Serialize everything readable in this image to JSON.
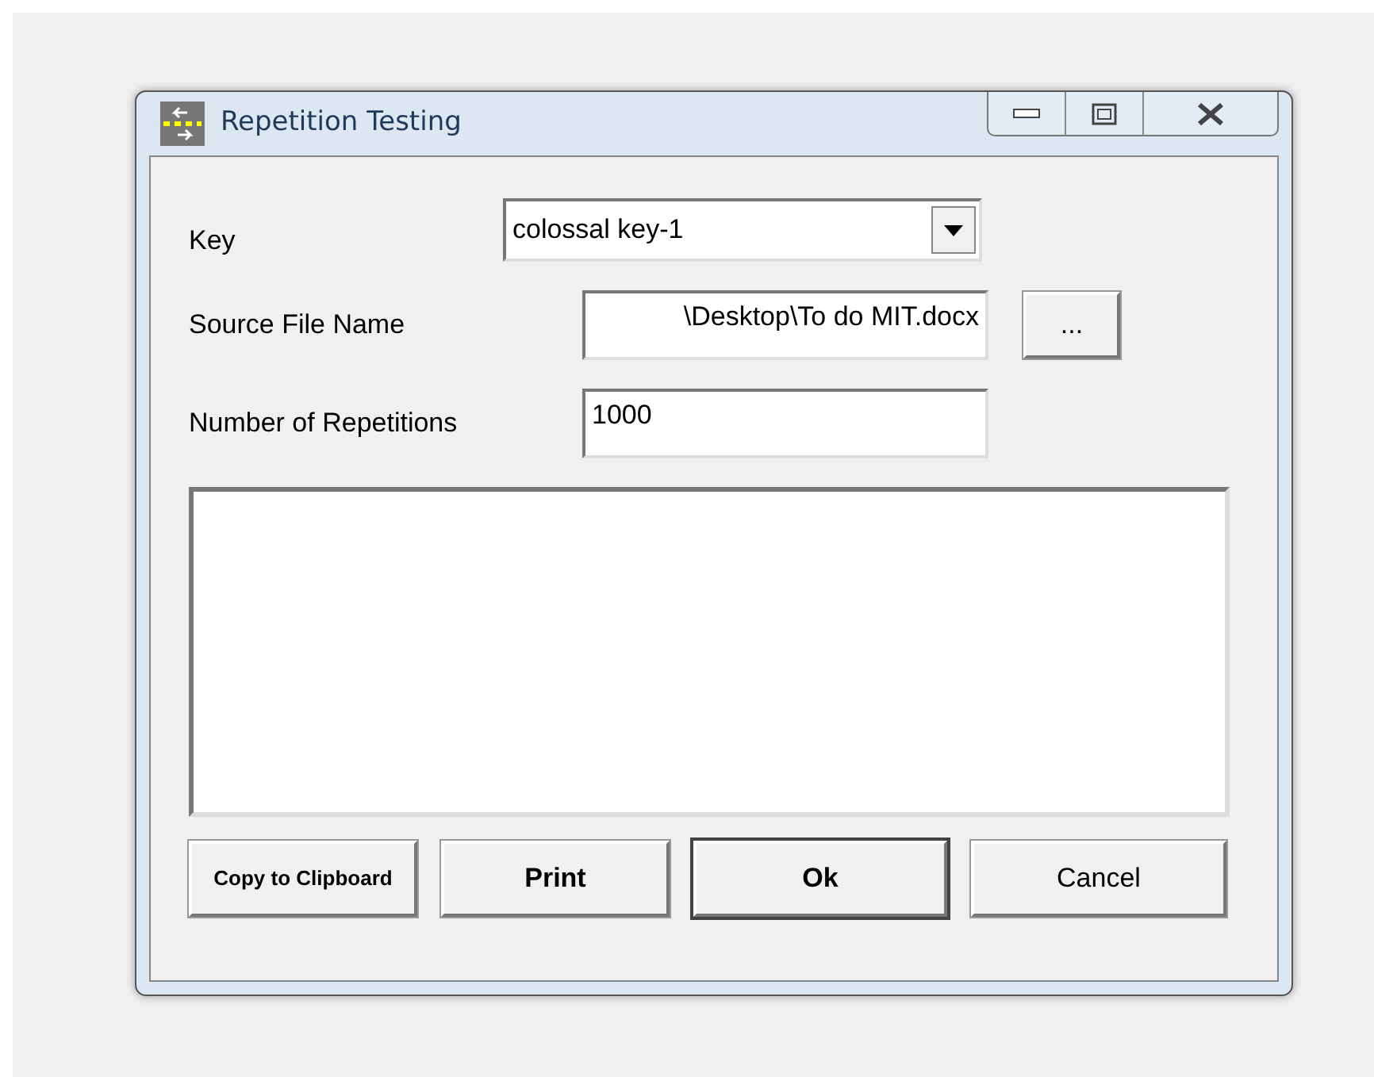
{
  "window": {
    "title": "Repetition Testing"
  },
  "fields": [
    {
      "kind": "combo",
      "label": "Key",
      "value": "colossal key-1"
    },
    {
      "kind": "browse",
      "label": "Source File Name",
      "value": "\\Desktop\\To do MIT.docx",
      "button": "..."
    },
    {
      "kind": "text",
      "label": "Number of Repetitions",
      "value": "1000"
    }
  ],
  "buttons": [
    {
      "label": "Copy to Clipboard",
      "kind": "compact",
      "default": false
    },
    {
      "label": "Print",
      "kind": "strong",
      "default": false
    },
    {
      "label": "Ok",
      "kind": "strong",
      "default": true
    },
    {
      "label": "Cancel",
      "kind": "plain",
      "default": false
    }
  ]
}
